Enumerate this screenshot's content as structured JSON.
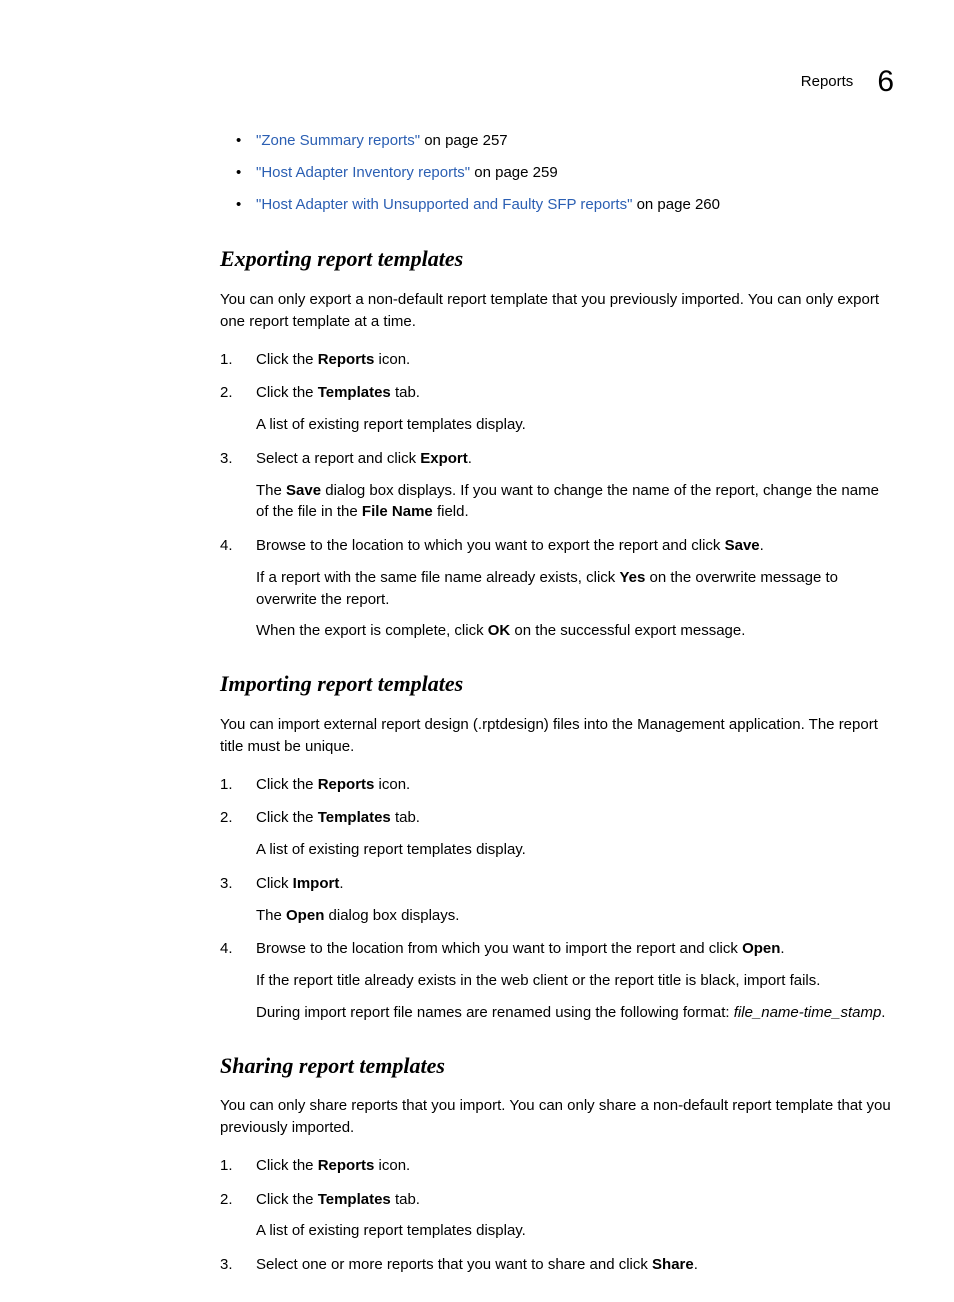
{
  "header": {
    "label": "Reports",
    "number": "6"
  },
  "bullets": [
    {
      "link": "\"Zone Summary reports\"",
      "after": " on page 257"
    },
    {
      "link": "\"Host Adapter Inventory reports\"",
      "after": " on page 259"
    },
    {
      "link": "\"Host Adapter with Unsupported and Faulty SFP reports\"",
      "after": " on page 260"
    }
  ],
  "s1": {
    "title": "Exporting report templates",
    "intro": "You can only export a non-default report template that you previously imported. You can only export one report template at a time.",
    "step1_a": "Click the ",
    "step1_b": "Reports",
    "step1_c": " icon.",
    "step2_a": "Click the ",
    "step2_b": "Templates",
    "step2_c": " tab.",
    "step2_sub": "A list of existing report templates display.",
    "step3_a": "Select a report and click ",
    "step3_b": "Export",
    "step3_c": ".",
    "step3_sub_a": "The ",
    "step3_sub_b": "Save",
    "step3_sub_c": " dialog box displays. If you want to change the name of the report, change the name of the file in the ",
    "step3_sub_d": "File Name",
    "step3_sub_e": " field.",
    "step4_a": "Browse to the location to which you want to export the report and click ",
    "step4_b": "Save",
    "step4_c": ".",
    "step4_sub1_a": "If a report with the same file name already exists, click ",
    "step4_sub1_b": "Yes",
    "step4_sub1_c": " on the overwrite message to overwrite the report.",
    "step4_sub2_a": "When the export is complete, click ",
    "step4_sub2_b": "OK",
    "step4_sub2_c": " on the successful export message."
  },
  "s2": {
    "title": "Importing report templates",
    "intro": "You can import external report design (.rptdesign) files into the Management application. The report title must be unique.",
    "step1_a": "Click the ",
    "step1_b": "Reports",
    "step1_c": " icon.",
    "step2_a": "Click the ",
    "step2_b": "Templates",
    "step2_c": " tab.",
    "step2_sub": "A list of existing report templates display.",
    "step3_a": "Click ",
    "step3_b": "Import",
    "step3_c": ".",
    "step3_sub_a": "The ",
    "step3_sub_b": "Open",
    "step3_sub_c": " dialog box displays.",
    "step4_a": "Browse to the location from which you want to import the report and click ",
    "step4_b": "Open",
    "step4_c": ".",
    "step4_sub1": "If the report title already exists in the web client or the report title is black, import fails.",
    "step4_sub2_a": "During import report file names are renamed using the following format: ",
    "step4_sub2_b": "file_name-time_stamp",
    "step4_sub2_c": "."
  },
  "s3": {
    "title": "Sharing report templates",
    "intro": "You can only share reports that you import. You can only share a non-default report template that you previously imported.",
    "step1_a": "Click the ",
    "step1_b": "Reports",
    "step1_c": " icon.",
    "step2_a": "Click the ",
    "step2_b": "Templates",
    "step2_c": " tab.",
    "step2_sub": "A list of existing report templates display.",
    "step3_a": "Select one or more reports that you want to share and click ",
    "step3_b": "Share",
    "step3_c": "."
  }
}
